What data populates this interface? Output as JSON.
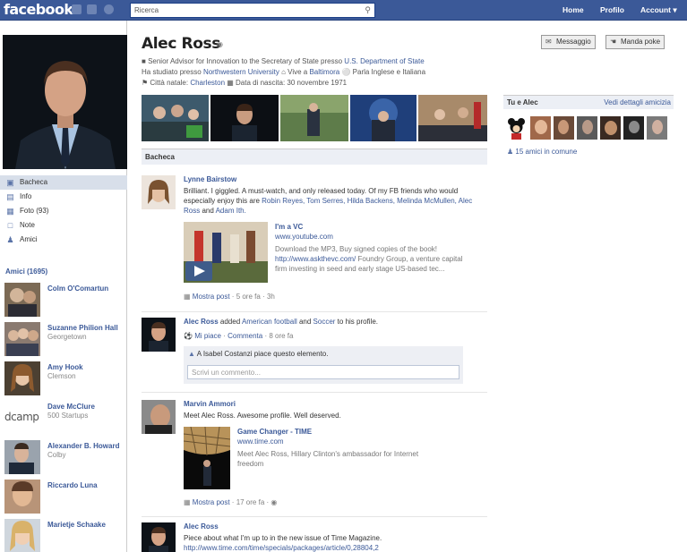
{
  "topbar": {
    "logo": "facebook",
    "search_placeholder": "Ricerca",
    "nav": [
      "Home",
      "Profilo",
      "Account"
    ]
  },
  "left": {
    "menu": [
      {
        "label": "Bacheca",
        "icon": "wall-icon",
        "selected": true
      },
      {
        "label": "Info",
        "icon": "info-icon"
      },
      {
        "label": "Foto (93)",
        "icon": "photos-icon"
      },
      {
        "label": "Note",
        "icon": "notes-icon"
      },
      {
        "label": "Amici",
        "icon": "friends-icon"
      }
    ],
    "friends_heading": "Amici (1695)",
    "friends": [
      {
        "name": "Colm O'Comartun",
        "sub": ""
      },
      {
        "name": "Suzanne Philion Hall",
        "sub": "Georgetown"
      },
      {
        "name": "Amy Hook",
        "sub": "Clemson"
      },
      {
        "name": "Dave McClure",
        "sub": "500 Startups"
      },
      {
        "name": "Alexander B. Howard",
        "sub": "Colby"
      },
      {
        "name": "Riccardo Luna",
        "sub": ""
      },
      {
        "name": "Marietje Schaake",
        "sub": ""
      }
    ],
    "dcamp_logo": "dcamp"
  },
  "profile": {
    "name": "Alec Ross",
    "line1_pre": "Senior Advisor for Innovation to the Secretary of State presso ",
    "line1_link": "U.S. Department of State",
    "line2_pre": "Ha studiato presso ",
    "line2_link": "Northwestern University",
    "line2_mid": "Vive a ",
    "line2_link2": "Baltimora",
    "line2_lang": "Parla Inglese e Italiana",
    "line3_pre": "Città natale: ",
    "line3_link": "Charleston",
    "line3_birth": "Data di nascita: 30 novembre 1971",
    "btn_message": "Messaggio",
    "btn_poke": "Manda poke"
  },
  "wall_heading": "Bacheca",
  "posts": [
    {
      "author": "Lynne Bairstow",
      "text_pre": "Brilliant. I giggled. A must-watch, and only released today. Of my FB friends who would especially enjoy this are ",
      "text_links": "Robin Reyes, Tom Serres, Hilda Backens, Melinda McMullen, Alec Ross",
      "text_and": " and ",
      "text_last": "Adam Ith.",
      "att_title": "I'm a VC",
      "att_url": "www.youtube.com",
      "att_desc_pre": "Download the MP3, Buy signed copies of the book! ",
      "att_desc_link": "http://www.askthevc.com/",
      "att_desc_post": " Foundry Group, a venture capital firm investing in seed and early stage US-based tec...",
      "meta_link": "Mostra post",
      "meta_rest": " · 5 ore fa · ",
      "meta_count": "3h"
    },
    {
      "author": "Alec Ross",
      "text_mid": " added ",
      "link1": "American football",
      "text_and": " and ",
      "link2": "Soccer",
      "text_end": " to his profile.",
      "like": "Mi piace",
      "comment": "Commenta",
      "time": " · 8 ore fa",
      "likes_line": "A Isabel Costanzi piace questo elemento.",
      "comment_placeholder": "Scrivi un commento..."
    },
    {
      "author": "Marvin Ammori",
      "text": "Meet Alec Ross. Awesome profile. Well deserved.",
      "att_title": "Game Changer - TIME",
      "att_url": "www.time.com",
      "att_desc": "Meet Alec Ross, Hillary Clinton's ambassador for Internet freedom",
      "meta_link": "Mostra post",
      "meta_rest": " · 17 ore fa · "
    },
    {
      "author": "Alec Ross",
      "text": "Piece about what I'm up to in the new issue of Time Magazine.",
      "url": "http://www.time.com/time/specials/packages/article/0,28804,2"
    }
  ],
  "right": {
    "tu_e": "Tu e Alec",
    "dettagli": "Vedi dettagli amicizia",
    "mutual": "15 amici in comune"
  }
}
